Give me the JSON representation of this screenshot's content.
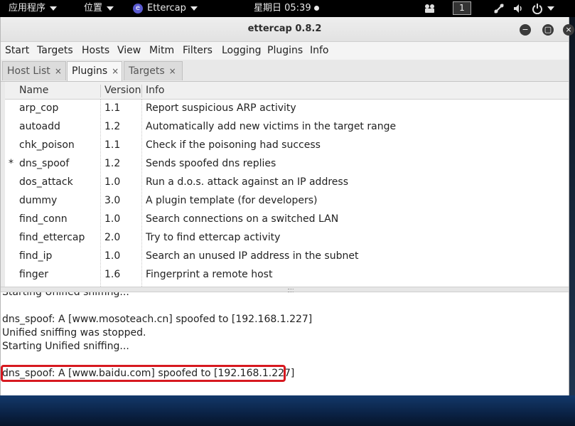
{
  "topbar": {
    "apps_menu": "应用程序",
    "places_menu": "位置",
    "active_app": "Ettercap",
    "clock": "星期日 05:39",
    "workspace": "1"
  },
  "window": {
    "title": "ettercap 0.8.2"
  },
  "menubar": [
    "Start",
    "Targets",
    "Hosts",
    "View",
    "Mitm",
    "Filters",
    "Logging",
    "Plugins",
    "Info"
  ],
  "tabs": [
    {
      "label": "Host List",
      "active": false
    },
    {
      "label": "Plugins",
      "active": true
    },
    {
      "label": "Targets",
      "active": false
    }
  ],
  "plugins_table": {
    "columns": [
      "Name",
      "Version",
      "Info"
    ],
    "rows": [
      {
        "mark": "",
        "name": "arp_cop",
        "version": "1.1",
        "info": "Report suspicious ARP activity"
      },
      {
        "mark": "",
        "name": "autoadd",
        "version": "1.2",
        "info": "Automatically add new victims in the target range"
      },
      {
        "mark": "",
        "name": "chk_poison",
        "version": "1.1",
        "info": "Check if the poisoning had success"
      },
      {
        "mark": "*",
        "name": "dns_spoof",
        "version": "1.2",
        "info": "Sends spoofed dns replies"
      },
      {
        "mark": "",
        "name": "dos_attack",
        "version": "1.0",
        "info": "Run a d.o.s. attack against an IP address"
      },
      {
        "mark": "",
        "name": "dummy",
        "version": "3.0",
        "info": "A plugin template (for developers)"
      },
      {
        "mark": "",
        "name": "find_conn",
        "version": "1.0",
        "info": "Search connections on a switched LAN"
      },
      {
        "mark": "",
        "name": "find_ettercap",
        "version": "2.0",
        "info": "Try to find ettercap activity"
      },
      {
        "mark": "",
        "name": "find_ip",
        "version": "1.0",
        "info": "Search an unused IP address in the subnet"
      },
      {
        "mark": "",
        "name": "finger",
        "version": "1.6",
        "info": "Fingerprint a remote host"
      }
    ]
  },
  "log": {
    "lines": [
      "Starting Unified sniffing...",
      "",
      "dns_spoof: A [www.mosoteach.cn] spoofed to [192.168.1.227]",
      "Unified sniffing was stopped.",
      "Starting Unified sniffing...",
      "",
      "dns_spoof: A [www.baidu.com] spoofed to [192.168.1.227]"
    ]
  },
  "colors": {
    "highlight_border": "#d71920",
    "panel_bg": "#000000"
  }
}
